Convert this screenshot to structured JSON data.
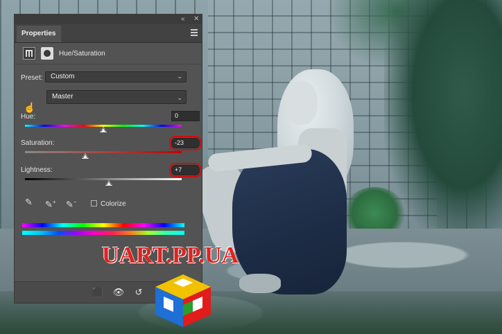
{
  "panel": {
    "tab_label": "Properties",
    "collapse_glyph": "«",
    "close_glyph": "✕",
    "adjustment_title": "Hue/Saturation",
    "preset_label": "Preset:",
    "preset_value": "Custom",
    "channel_value": "Master",
    "hue_label": "Hue:",
    "hue_value": "0",
    "saturation_label": "Saturation:",
    "saturation_value": "-23",
    "lightness_label": "Lightness:",
    "lightness_value": "+7",
    "colorize_label": "Colorize",
    "colorize_checked": false,
    "slider_levels": {
      "hue": 0.5,
      "saturation": 0.385,
      "lightness": 0.535
    }
  },
  "icons": {
    "menu": "menu-icon",
    "adjustment_layer": "hue-saturation-grid-icon",
    "mask": "layer-mask-icon",
    "targeted_adjust": "hand-adjust-icon",
    "eyedropper": "eyedropper-icon",
    "eyedropper_plus": "eyedropper-add-icon",
    "eyedropper_minus": "eyedropper-subtract-icon",
    "clip": "clip-to-layer-icon",
    "visibility": "visibility-icon",
    "reset": "reset-icon",
    "trash": "trash-icon"
  },
  "watermark": {
    "text": "UART.PP.UA"
  },
  "colors": {
    "panel_bg": "#535353",
    "highlight": "#d10c0c",
    "watermark": "#e0221f"
  }
}
